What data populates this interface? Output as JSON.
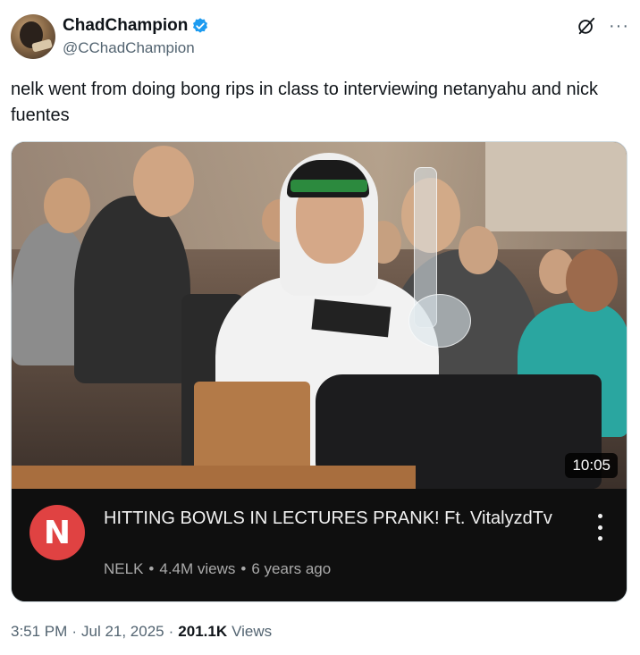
{
  "author": {
    "display_name": "ChadChampion",
    "handle": "@CChadChampion"
  },
  "tweet": {
    "text": "nelk went from doing bong rips in class to interviewing netanyahu and nick fuentes"
  },
  "video": {
    "duration": "10:05",
    "channel_initial": "N",
    "title": "HITTING BOWLS IN LECTURES PRANK! Ft. VitalyzdTv",
    "channel": "NELK",
    "views": "4.4M views",
    "age": "6 years ago",
    "separator": "•"
  },
  "footer": {
    "time": "3:51 PM",
    "dot": "·",
    "date": "Jul 21, 2025",
    "views_count": "201.1K",
    "views_label": "Views"
  },
  "icons": {
    "verified": "verified-badge-icon",
    "grok": "grok-icon",
    "more": "more-icon",
    "kebab": "kebab-menu-icon"
  },
  "colors": {
    "verified": "#1d9bf0",
    "channel_logo": "#e04242",
    "secondary_text": "#536471"
  }
}
